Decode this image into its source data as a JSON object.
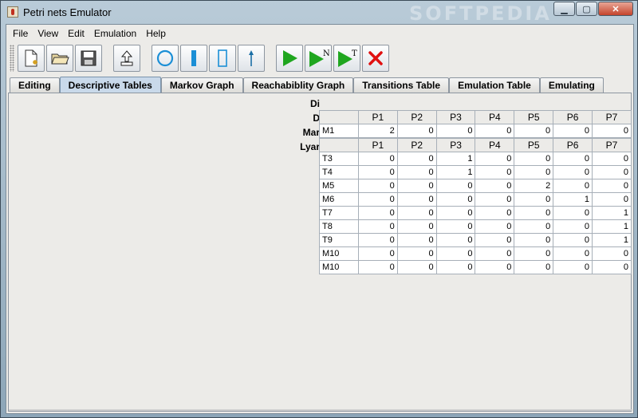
{
  "window": {
    "title": "Petri nets Emulator",
    "watermark": "SOFTPEDIA",
    "controls": {
      "minimize": "▁",
      "maximize": "▢",
      "close": "✕"
    }
  },
  "menu": [
    "File",
    "View",
    "Edit",
    "Emulation",
    "Help"
  ],
  "toolbar": {
    "buttons": [
      {
        "name": "new-file-icon"
      },
      {
        "name": "open-folder-icon"
      },
      {
        "name": "save-disk-icon"
      },
      {
        "name": "export-upload-icon"
      },
      {
        "name": "place-circle-icon"
      },
      {
        "name": "transition-bar-icon"
      },
      {
        "name": "rectangle-icon"
      },
      {
        "name": "arc-arrow-icon"
      },
      {
        "name": "play-icon"
      },
      {
        "name": "play-n-icon",
        "label": "N"
      },
      {
        "name": "play-t-icon",
        "label": "T"
      },
      {
        "name": "stop-x-icon"
      }
    ]
  },
  "tabs": [
    "Editing",
    "Descriptive Tables",
    "Markov Graph",
    "Reachabiblity Graph",
    "Transitions Table",
    "Emulation Table",
    "Emulating"
  ],
  "active_tab": "Descriptive Tables",
  "row_labels": [
    "Di",
    "D",
    "Mar",
    "Lyar"
  ],
  "columns": [
    "P1",
    "P2",
    "P3",
    "P4",
    "P5",
    "P6",
    "P7"
  ],
  "marking_table": {
    "rows": [
      {
        "name": "M1",
        "values": [
          "2",
          "0",
          "0",
          "0",
          "0",
          "0",
          "0"
        ]
      }
    ]
  },
  "lyapunov_table": {
    "rows": [
      {
        "name": "T3",
        "values": [
          "0",
          "0",
          "1",
          "0",
          "0",
          "0",
          "0"
        ]
      },
      {
        "name": "T4",
        "values": [
          "0",
          "0",
          "1",
          "0",
          "0",
          "0",
          "0"
        ]
      },
      {
        "name": "M5",
        "values": [
          "0",
          "0",
          "0",
          "0",
          "2",
          "0",
          "0"
        ]
      },
      {
        "name": "M6",
        "values": [
          "0",
          "0",
          "0",
          "0",
          "0",
          "1",
          "0"
        ]
      },
      {
        "name": "T7",
        "values": [
          "0",
          "0",
          "0",
          "0",
          "0",
          "0",
          "1"
        ]
      },
      {
        "name": "T8",
        "values": [
          "0",
          "0",
          "0",
          "0",
          "0",
          "0",
          "1"
        ]
      },
      {
        "name": "T9",
        "values": [
          "0",
          "0",
          "0",
          "0",
          "0",
          "0",
          "1"
        ]
      },
      {
        "name": "M10",
        "values": [
          "0",
          "0",
          "0",
          "0",
          "0",
          "0",
          "0"
        ]
      },
      {
        "name": "M10",
        "values": [
          "0",
          "0",
          "0",
          "0",
          "0",
          "0",
          "0"
        ]
      }
    ]
  },
  "colors": {
    "accent": "#c9d9ea",
    "play_green": "#1fa61f",
    "stop_red": "#e01010",
    "place_blue": "#1b8fd6"
  }
}
